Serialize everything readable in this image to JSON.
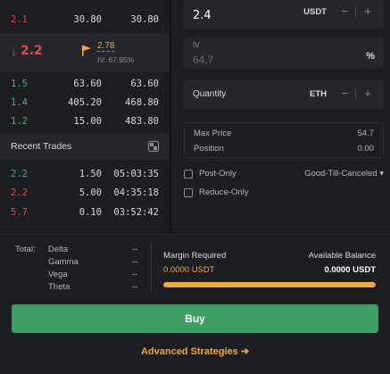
{
  "orderbook": {
    "asks": [
      {
        "price": "2.1",
        "size": "30.80",
        "total": "30.80"
      }
    ],
    "mid": {
      "change": "2.2",
      "mark_price": "2.78",
      "iv": "IV: 67.95%"
    },
    "bids": [
      {
        "price": "1.5",
        "size": "63.60",
        "total": "63.60"
      },
      {
        "price": "1.4",
        "size": "405.20",
        "total": "468.80"
      },
      {
        "price": "1.2",
        "size": "15.00",
        "total": "483.80"
      }
    ]
  },
  "recent_trades": {
    "title": "Recent Trades",
    "rows": [
      {
        "price": "2.2",
        "size": "1.50",
        "time": "05:03:35",
        "side": "green"
      },
      {
        "price": "2.2",
        "size": "5.00",
        "time": "04:35:18",
        "side": "red"
      },
      {
        "price": "5.7",
        "size": "0.10",
        "time": "03:52:42",
        "side": "red"
      }
    ]
  },
  "order_form": {
    "price": {
      "value": "2.4",
      "unit": "USDT",
      "minus": "−",
      "plus": "+"
    },
    "iv": {
      "label": "IV",
      "placeholder": "64.7",
      "unit": "%"
    },
    "quantity": {
      "label": "Quantity",
      "unit": "ETH",
      "minus": "−",
      "plus": "+"
    },
    "max_price": {
      "label": "Max Price",
      "value": "54.7"
    },
    "position": {
      "label": "Position",
      "value": "0.00"
    },
    "post_only": "Post-Only",
    "reduce_only": "Reduce-Only",
    "time_in_force": "Good-Till-Canceled ▾"
  },
  "greeks": {
    "total_label": "Total:",
    "items": [
      {
        "name": "Delta",
        "value": "--"
      },
      {
        "name": "Gamma",
        "value": "--"
      },
      {
        "name": "Vega",
        "value": "--"
      },
      {
        "name": "Theta",
        "value": "--"
      }
    ]
  },
  "margin": {
    "required_label": "Margin Required",
    "required_value": "0.0000 USDT",
    "available_label": "Available Balance",
    "available_value": "0.0000 USDT",
    "bar_fraction": 1.0
  },
  "buy_label": "Buy",
  "advanced_label": "Advanced Strategies ➔",
  "colors": {
    "accent": "#f0a73c",
    "buy": "#3e9e63",
    "ask": "#e5484d",
    "bid": "#3fb878"
  }
}
